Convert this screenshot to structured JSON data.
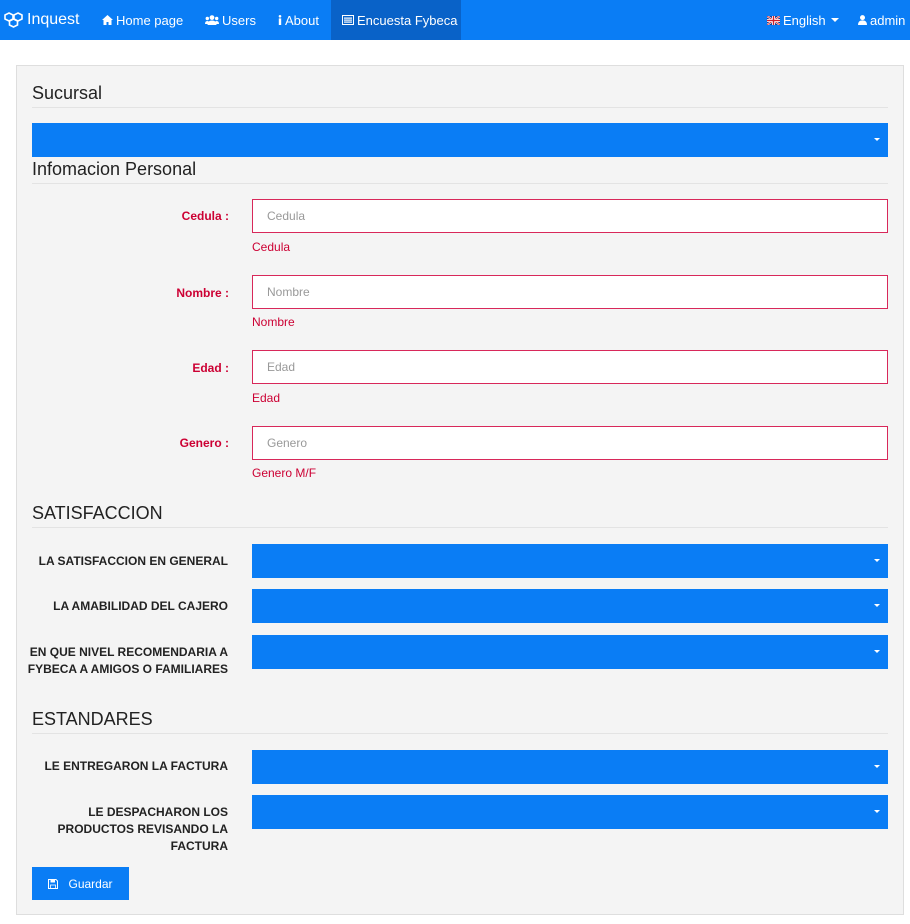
{
  "navbar": {
    "brand": "Inquest",
    "home": "Home page",
    "users": "Users",
    "about": "About",
    "survey": "Encuesta Fybeca",
    "language": "English",
    "user": "admin",
    "colors": {
      "primary": "#0a7df5",
      "active": "#0962c8"
    }
  },
  "sucursal": {
    "title": "Sucursal",
    "selected": ""
  },
  "personal": {
    "title": "Infomacion Personal",
    "fields": [
      {
        "label": "Cedula :",
        "placeholder": "Cedula",
        "help": "Cedula"
      },
      {
        "label": "Nombre :",
        "placeholder": "Nombre",
        "help": "Nombre"
      },
      {
        "label": "Edad :",
        "placeholder": "Edad",
        "help": "Edad"
      },
      {
        "label": "Genero :",
        "placeholder": "Genero",
        "help": "Genero M/F"
      }
    ]
  },
  "satisfaccion": {
    "title": "SATISFACCION",
    "questions": [
      "LA SATISFACCION EN GENERAL",
      "LA AMABILIDAD DEL CAJERO",
      "EN QUE NIVEL RECOMENDARIA A FYBECA A AMIGOS O FAMILIARES"
    ]
  },
  "estandares": {
    "title": "ESTANDARES",
    "questions": [
      "LE ENTREGARON LA FACTURA",
      "LE DESPACHARON LOS PRODUCTOS REVISANDO LA FACTURA"
    ]
  },
  "save_label": "Guardar"
}
